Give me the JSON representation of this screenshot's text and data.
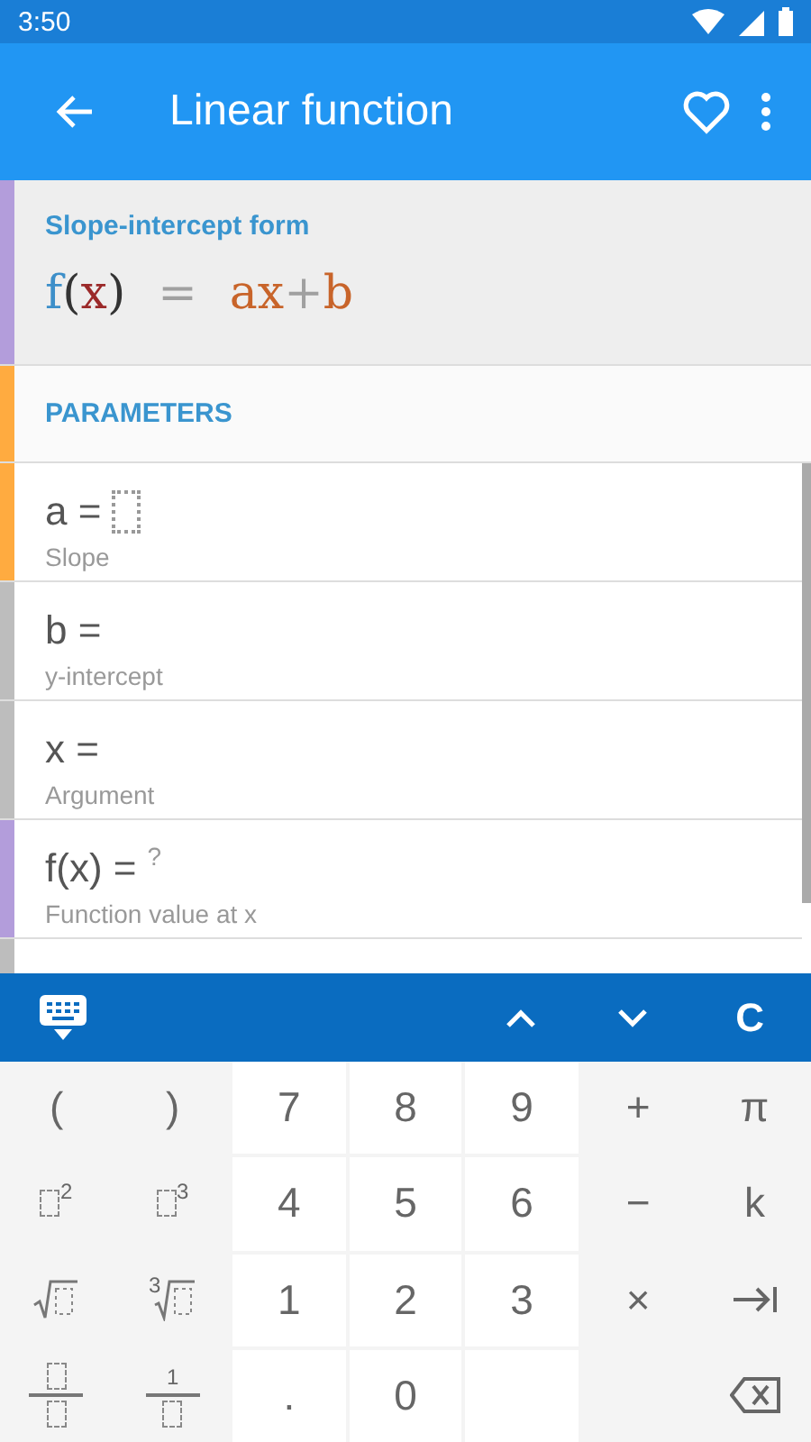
{
  "status_bar": {
    "time": "3:50"
  },
  "app_bar": {
    "title": "Linear function",
    "favorite": false
  },
  "formula": {
    "title": "Slope-intercept form",
    "color": "#b39ddb",
    "parts": [
      {
        "text": "f",
        "color": "#3d8fc9"
      },
      {
        "text": "(",
        "color": "#333333"
      },
      {
        "text": "x",
        "color": "#9b2a2a"
      },
      {
        "text": ")",
        "color": "#333333"
      },
      {
        "text": "=",
        "color": "#a0a0a0"
      },
      {
        "text": "ax",
        "color": "#c8642a"
      },
      {
        "text": "+",
        "color": "#a0a0a0"
      },
      {
        "text": "b",
        "color": "#c8642a"
      }
    ]
  },
  "parameters": {
    "title": "PARAMETERS",
    "color": "#ffab40",
    "rows": [
      {
        "label": "a =",
        "hint": "Slope",
        "color": "#ffab40",
        "focused": true
      },
      {
        "label": "b =",
        "hint": "y-intercept",
        "color": "#bdbdbd",
        "focused": false
      },
      {
        "label": "x =",
        "hint": "Argument",
        "color": "#bdbdbd",
        "focused": false
      },
      {
        "label": "f(x) =",
        "value": "?",
        "hint": "Function value at x",
        "color": "#b39ddb",
        "focused": false
      }
    ],
    "partial_row": {
      "color": "#bdbdbd"
    }
  },
  "keyboard": {
    "clear": "C",
    "keys": [
      {
        "kind": "text",
        "label": "("
      },
      {
        "kind": "text",
        "label": ")"
      },
      {
        "kind": "text",
        "label": "7"
      },
      {
        "kind": "text",
        "label": "8"
      },
      {
        "kind": "text",
        "label": "9"
      },
      {
        "kind": "text",
        "label": "+"
      },
      {
        "kind": "text",
        "label": "π"
      },
      {
        "kind": "power",
        "label": "2"
      },
      {
        "kind": "power",
        "label": "3"
      },
      {
        "kind": "text",
        "label": "4"
      },
      {
        "kind": "text",
        "label": "5"
      },
      {
        "kind": "text",
        "label": "6"
      },
      {
        "kind": "text",
        "label": "−"
      },
      {
        "kind": "text",
        "label": "k"
      },
      {
        "kind": "sqrt"
      },
      {
        "kind": "root",
        "label": "3"
      },
      {
        "kind": "text",
        "label": "1"
      },
      {
        "kind": "text",
        "label": "2"
      },
      {
        "kind": "text",
        "label": "3"
      },
      {
        "kind": "text",
        "label": "×"
      },
      {
        "kind": "tab"
      },
      {
        "kind": "fraction"
      },
      {
        "kind": "reciprocal",
        "label": "1"
      },
      {
        "kind": "text",
        "label": "."
      },
      {
        "kind": "text",
        "label": "0"
      },
      {
        "kind": "empty"
      },
      {
        "kind": "empty"
      },
      {
        "kind": "backspace"
      }
    ]
  }
}
